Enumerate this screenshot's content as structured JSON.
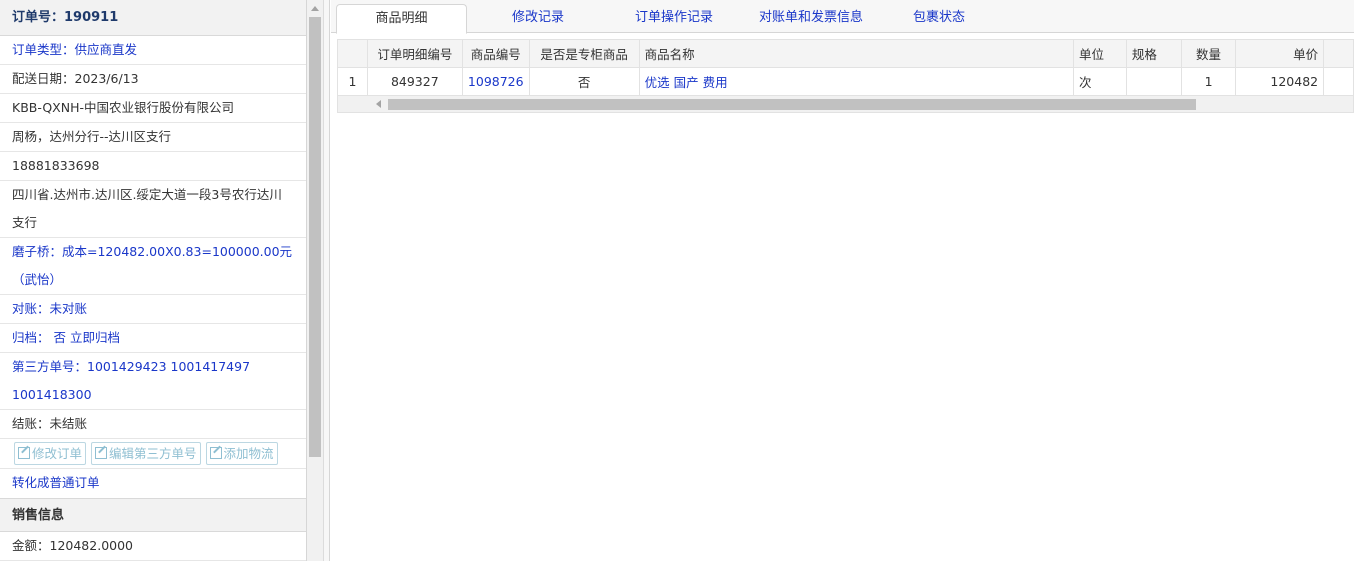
{
  "order": {
    "title": "订单号：190911",
    "type": "订单类型：供应商直发",
    "delivery_date": "配送日期：2023/6/13",
    "company": "KBB-QXNH-中国农业银行股份有限公司",
    "contact": "周杨，达州分行--达川区支行",
    "phone": "18881833698",
    "address": "四川省.达州市.达川区.绥定大道一段3号农行达川支行",
    "cost_note": "磨子桥：成本=120482.00X0.83=100000.00元（武怡）",
    "reconcile": "对账：未对账",
    "archive_label": "归档：",
    "archive_value": "否",
    "archive_link": "立即归档",
    "third_party": "第三方单号：1001429423 1001417497 1001418300",
    "settle": "结账：未结账",
    "buttons": [
      "修改订单",
      "编辑第三方单号",
      "添加物流"
    ],
    "convert": "转化成普通订单"
  },
  "sales": {
    "title": "销售信息",
    "amount": "金额：120482.0000"
  },
  "tabs": [
    "商品明细",
    "修改记录",
    "订单操作记录",
    "对账单和发票信息",
    "包裹状态"
  ],
  "table": {
    "headers": [
      "",
      "订单明细编号",
      "商品编号",
      "是否是专柜商品",
      "商品名称",
      "单位",
      "规格",
      "数量",
      "单价"
    ],
    "rows": [
      [
        "1",
        "849327",
        "1098726",
        "否",
        "优选 国产 费用",
        "次",
        "",
        "1",
        "120482"
      ]
    ]
  },
  "colors": {
    "link": "#1a37c9",
    "button_disabled": "#8fbfd2"
  }
}
